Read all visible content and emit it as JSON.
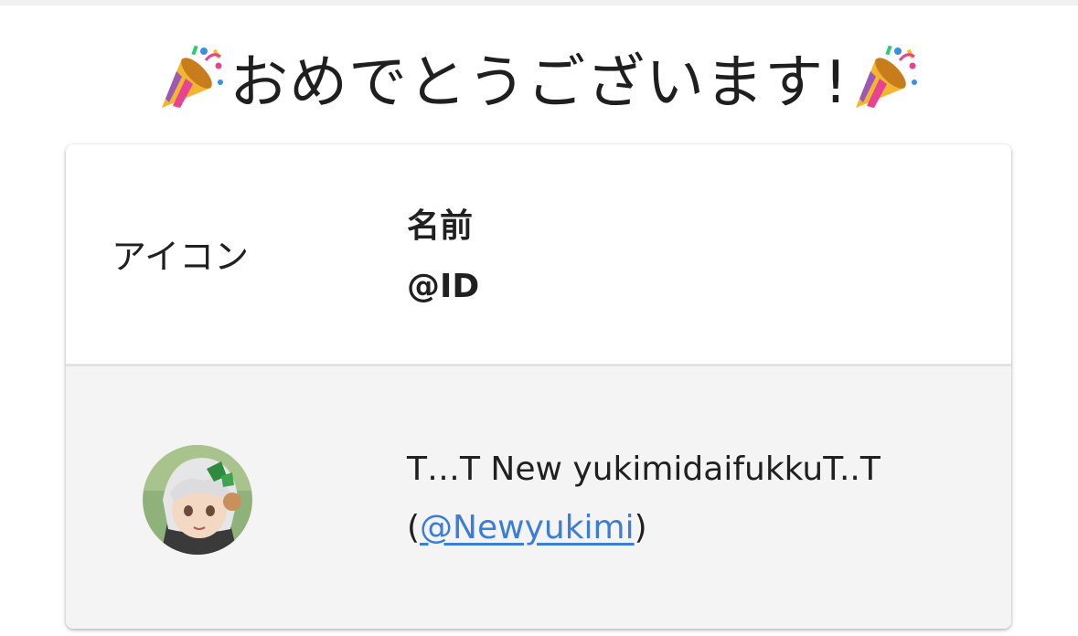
{
  "title": {
    "left_icon": "party-popper-icon",
    "text": "おめでとうございます!",
    "right_icon": "party-popper-icon"
  },
  "table": {
    "headers": {
      "icon": "アイコン",
      "name": "名前",
      "id": "@ID"
    },
    "rows": [
      {
        "avatar": "avatar-image",
        "name": "T…T New yukimidaifukkuT..T",
        "open_paren": "(",
        "handle": "@Newyukimi",
        "close_paren": ")"
      }
    ]
  },
  "colors": {
    "link": "#3b7dd8",
    "row_background": "#f4f4f4",
    "text": "#202020"
  }
}
